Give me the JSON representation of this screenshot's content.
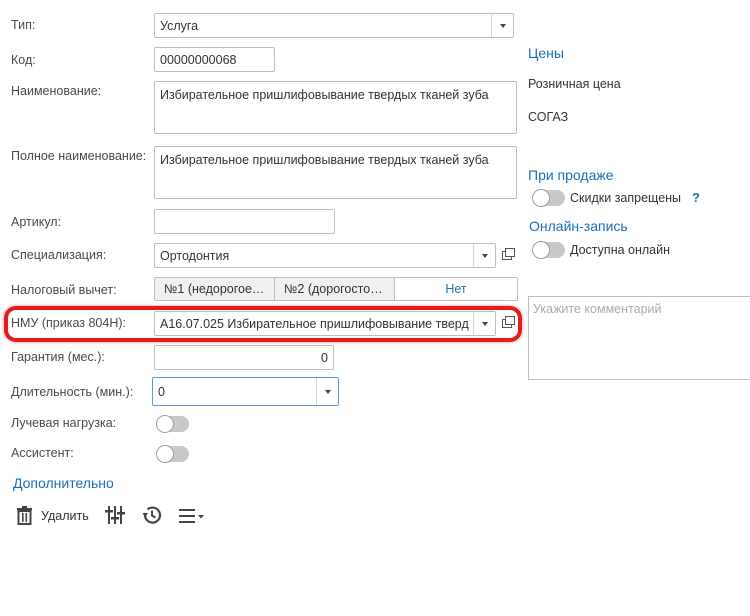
{
  "form": {
    "type": {
      "label": "Тип:",
      "value": "Услуга"
    },
    "code": {
      "label": "Код:",
      "value": "00000000068"
    },
    "name": {
      "label": "Наименование:",
      "value": "Избирательное пришлифовывание твердых тканей зуба"
    },
    "full_name": {
      "label": "Полное наименование:",
      "value": "Избирательное пришлифовывание твердых тканей зуба"
    },
    "article": {
      "label": "Артикул:",
      "value": ""
    },
    "specialization": {
      "label": "Специализация:",
      "value": "Ортодонтия"
    },
    "tax_deduction": {
      "label": "Налоговый вычет:",
      "options": [
        "№1 (недорогое…",
        "№2 (дорогосто…",
        "Нет"
      ],
      "selected": "Нет"
    },
    "nmu": {
      "label": "НМУ (приказ 804Н):",
      "value": "A16.07.025 Избирательное пришлифовывание тверд"
    },
    "warranty": {
      "label": "Гарантия (мес.):",
      "value": "0"
    },
    "duration": {
      "label": "Длительность (мин.):",
      "value": "0"
    },
    "radiation": {
      "label": "Лучевая нагрузка:",
      "on": false
    },
    "assistant": {
      "label": "Ассистент:",
      "on": false
    },
    "more_link": "Дополнительно"
  },
  "prices": {
    "header": "Цены",
    "retail_label": "Розничная цена",
    "insurer": "СОГАЗ"
  },
  "sale": {
    "header": "При продаже",
    "discounts_label": "Скидки запрещены",
    "help": "?",
    "discounts_on": false
  },
  "online": {
    "header": "Онлайн-запись",
    "available_label": "Доступна онлайн",
    "available_on": false
  },
  "comment": {
    "placeholder": "Укажите комментарий"
  },
  "toolbar": {
    "delete_label": "Удалить"
  },
  "colors": {
    "link": "#1a6fba",
    "highlight": "#e41b1b",
    "toggle_off": "#c8c8c8"
  }
}
